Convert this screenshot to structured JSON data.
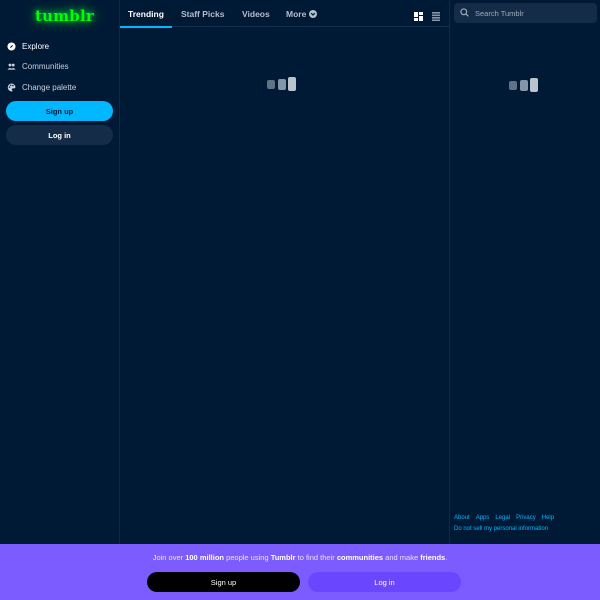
{
  "logo": "tumblr",
  "sidebar": {
    "items": [
      {
        "label": "Explore",
        "icon": "compass-icon"
      },
      {
        "label": "Communities",
        "icon": "people-icon"
      },
      {
        "label": "Change palette",
        "icon": "palette-icon"
      }
    ],
    "signup_label": "Sign up",
    "login_label": "Log in"
  },
  "tabs": [
    {
      "label": "Trending",
      "active": true
    },
    {
      "label": "Staff Picks",
      "active": false
    },
    {
      "label": "Videos",
      "active": false
    },
    {
      "label": "More",
      "active": false
    }
  ],
  "view_icons": [
    "grid-view-icon",
    "list-view-icon"
  ],
  "search": {
    "placeholder": "Search Tumblr",
    "icon": "search-icon"
  },
  "footer": {
    "links": [
      "About",
      "Apps",
      "Legal",
      "Privacy",
      "Help"
    ],
    "privacy_link": "Do not sell my personal information"
  },
  "banner": {
    "text_parts": [
      "Join over ",
      "100 million",
      " people using ",
      "Tumblr",
      " to find their ",
      "communities",
      " and make ",
      "friends",
      "."
    ],
    "signup_label": "Sign up",
    "login_label": "Log in"
  },
  "colors": {
    "background": "#001935",
    "accent": "#00b8ff",
    "banner": "#7c5cff",
    "logo": "#00ff00"
  }
}
